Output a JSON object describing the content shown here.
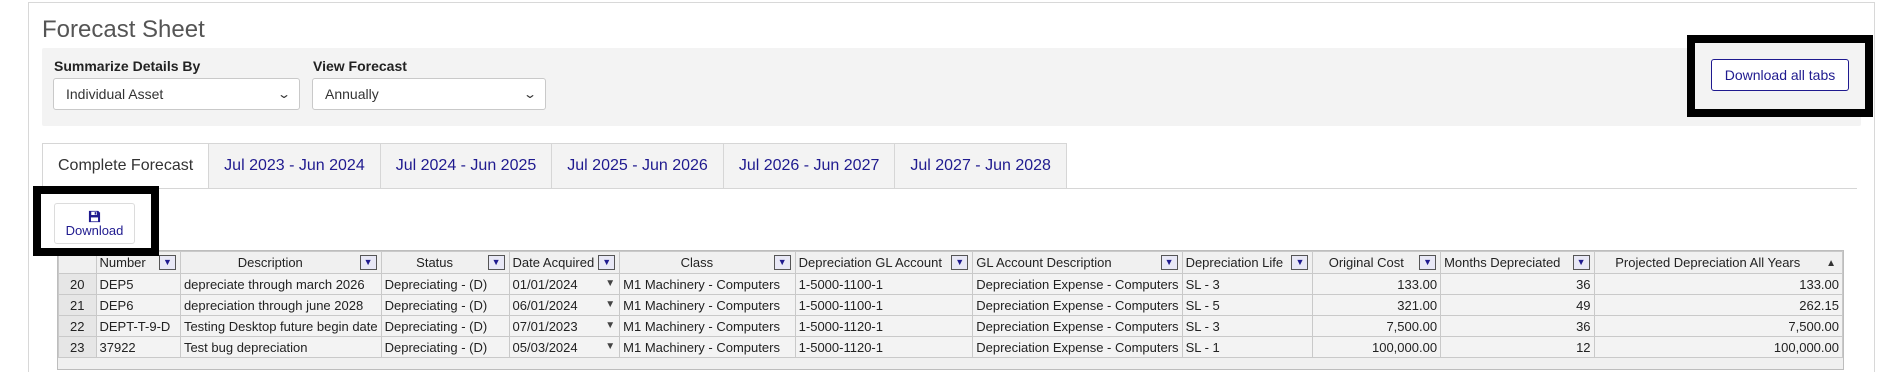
{
  "page": {
    "title": "Forecast Sheet"
  },
  "filters": {
    "summarize": {
      "label": "Summarize Details By",
      "value": "Individual Asset"
    },
    "view": {
      "label": "View Forecast",
      "value": "Annually"
    }
  },
  "actions": {
    "download_all": "Download all tabs",
    "download": "Download"
  },
  "tabs": [
    {
      "label": "Complete Forecast",
      "active": true
    },
    {
      "label": "Jul 2023 - Jun 2024",
      "active": false
    },
    {
      "label": "Jul 2024 - Jun 2025",
      "active": false
    },
    {
      "label": "Jul 2025 - Jun 2026",
      "active": false
    },
    {
      "label": "Jul 2026 - Jun 2027",
      "active": false
    },
    {
      "label": "Jul 2027 - Jun 2028",
      "active": false
    }
  ],
  "grid": {
    "columns": [
      "Number",
      "Description",
      "Status",
      "Date Acquired",
      "Class",
      "Depreciation GL Account",
      "GL Account Description",
      "Depreciation Life",
      "Original Cost",
      "Months Depreciated",
      "Projected Depreciation All Years"
    ],
    "rows": [
      {
        "row": "20",
        "cells": [
          "DEP5",
          "depreciate through march 2026",
          "Depreciating - (D)",
          "01/01/2024",
          "M1 Machinery - Computers",
          "1-5000-1100-1",
          "Depreciation Expense - Computers",
          "SL - 3",
          "133.00",
          "36",
          "133.00"
        ]
      },
      {
        "row": "21",
        "cells": [
          "DEP6",
          "depreciation through june 2028",
          "Depreciating - (D)",
          "06/01/2024",
          "M1 Machinery - Computers",
          "1-5000-1100-1",
          "Depreciation Expense - Computers",
          "SL - 5",
          "321.00",
          "49",
          "262.15"
        ]
      },
      {
        "row": "22",
        "cells": [
          "DEPT-T-9-D",
          "Testing Desktop future begin date",
          "Depreciating - (D)",
          "07/01/2023",
          "M1 Machinery - Computers",
          "1-5000-1120-1",
          "Depreciation Expense - Computers",
          "SL - 3",
          "7,500.00",
          "36",
          "7,500.00"
        ]
      },
      {
        "row": "23",
        "cells": [
          "37922",
          "Test bug depreciation",
          "Depreciating - (D)",
          "05/03/2024",
          "M1 Machinery - Computers",
          "1-5000-1120-1",
          "Depreciation Expense - Computers",
          "SL - 1",
          "100,000.00",
          "12",
          "100,000.00"
        ]
      }
    ]
  },
  "colors": {
    "accent": "#1f1a8f",
    "panel_bg": "#f3f3f3",
    "highlight_box": "#000000"
  }
}
